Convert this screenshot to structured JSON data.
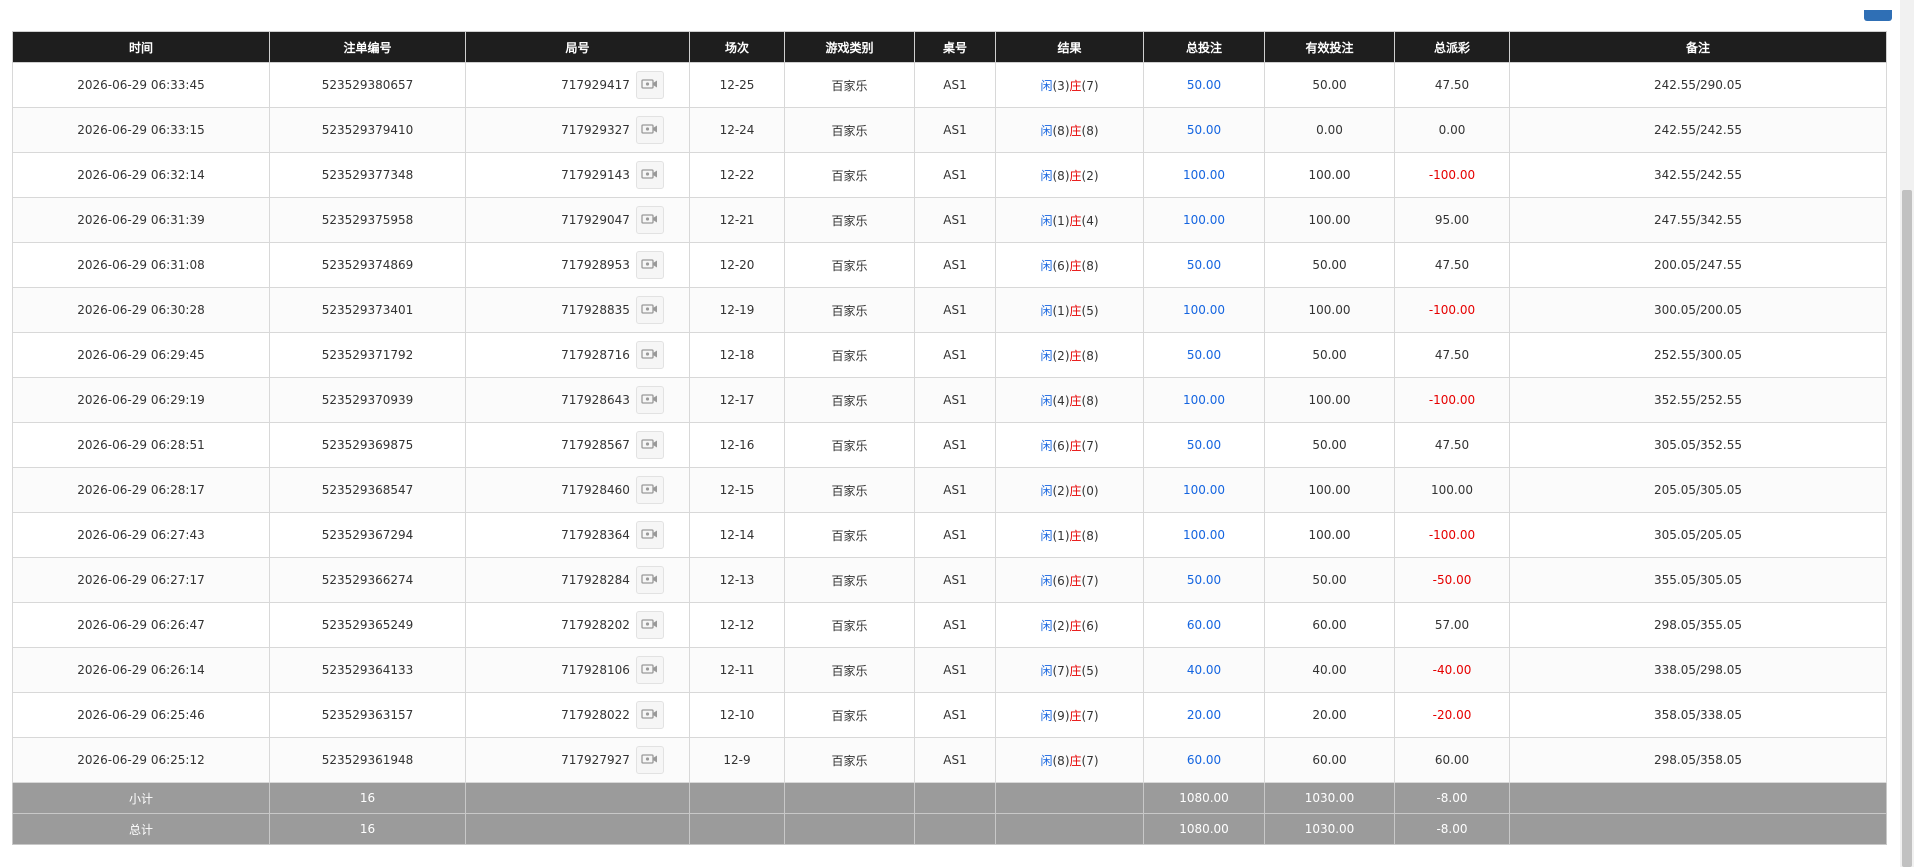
{
  "table": {
    "headers": [
      "时间",
      "注单编号",
      "局号",
      "场次",
      "游戏类别",
      "桌号",
      "结果",
      "总投注",
      "有效投注",
      "总派彩",
      "备注"
    ],
    "rows": [
      {
        "time": "2026-06-29 06:33:45",
        "bet_id": "523529380657",
        "round": "717929417",
        "session": "12-25",
        "game": "百家乐",
        "table": "AS1",
        "res_p_label": "闲",
        "res_p": "(3)",
        "res_b_label": "庄",
        "res_b": "(7)",
        "total_bet": "50.00",
        "valid_bet": "50.00",
        "payout": "47.50",
        "payout_negative": false,
        "note": "242.55/290.05"
      },
      {
        "time": "2026-06-29 06:33:15",
        "bet_id": "523529379410",
        "round": "717929327",
        "session": "12-24",
        "game": "百家乐",
        "table": "AS1",
        "res_p_label": "闲",
        "res_p": "(8)",
        "res_b_label": "庄",
        "res_b": "(8)",
        "total_bet": "50.00",
        "valid_bet": "0.00",
        "payout": "0.00",
        "payout_negative": false,
        "note": "242.55/242.55"
      },
      {
        "time": "2026-06-29 06:32:14",
        "bet_id": "523529377348",
        "round": "717929143",
        "session": "12-22",
        "game": "百家乐",
        "table": "AS1",
        "res_p_label": "闲",
        "res_p": "(8)",
        "res_b_label": "庄",
        "res_b": "(2)",
        "total_bet": "100.00",
        "valid_bet": "100.00",
        "payout": "-100.00",
        "payout_negative": true,
        "note": "342.55/242.55"
      },
      {
        "time": "2026-06-29 06:31:39",
        "bet_id": "523529375958",
        "round": "717929047",
        "session": "12-21",
        "game": "百家乐",
        "table": "AS1",
        "res_p_label": "闲",
        "res_p": "(1)",
        "res_b_label": "庄",
        "res_b": "(4)",
        "total_bet": "100.00",
        "valid_bet": "100.00",
        "payout": "95.00",
        "payout_negative": false,
        "note": "247.55/342.55"
      },
      {
        "time": "2026-06-29 06:31:08",
        "bet_id": "523529374869",
        "round": "717928953",
        "session": "12-20",
        "game": "百家乐",
        "table": "AS1",
        "res_p_label": "闲",
        "res_p": "(6)",
        "res_b_label": "庄",
        "res_b": "(8)",
        "total_bet": "50.00",
        "valid_bet": "50.00",
        "payout": "47.50",
        "payout_negative": false,
        "note": "200.05/247.55"
      },
      {
        "time": "2026-06-29 06:30:28",
        "bet_id": "523529373401",
        "round": "717928835",
        "session": "12-19",
        "game": "百家乐",
        "table": "AS1",
        "res_p_label": "闲",
        "res_p": "(1)",
        "res_b_label": "庄",
        "res_b": "(5)",
        "total_bet": "100.00",
        "valid_bet": "100.00",
        "payout": "-100.00",
        "payout_negative": true,
        "note": "300.05/200.05"
      },
      {
        "time": "2026-06-29 06:29:45",
        "bet_id": "523529371792",
        "round": "717928716",
        "session": "12-18",
        "game": "百家乐",
        "table": "AS1",
        "res_p_label": "闲",
        "res_p": "(2)",
        "res_b_label": "庄",
        "res_b": "(8)",
        "total_bet": "50.00",
        "valid_bet": "50.00",
        "payout": "47.50",
        "payout_negative": false,
        "note": "252.55/300.05"
      },
      {
        "time": "2026-06-29 06:29:19",
        "bet_id": "523529370939",
        "round": "717928643",
        "session": "12-17",
        "game": "百家乐",
        "table": "AS1",
        "res_p_label": "闲",
        "res_p": "(4)",
        "res_b_label": "庄",
        "res_b": "(8)",
        "total_bet": "100.00",
        "valid_bet": "100.00",
        "payout": "-100.00",
        "payout_negative": true,
        "note": "352.55/252.55"
      },
      {
        "time": "2026-06-29 06:28:51",
        "bet_id": "523529369875",
        "round": "717928567",
        "session": "12-16",
        "game": "百家乐",
        "table": "AS1",
        "res_p_label": "闲",
        "res_p": "(6)",
        "res_b_label": "庄",
        "res_b": "(7)",
        "total_bet": "50.00",
        "valid_bet": "50.00",
        "payout": "47.50",
        "payout_negative": false,
        "note": "305.05/352.55"
      },
      {
        "time": "2026-06-29 06:28:17",
        "bet_id": "523529368547",
        "round": "717928460",
        "session": "12-15",
        "game": "百家乐",
        "table": "AS1",
        "res_p_label": "闲",
        "res_p": "(2)",
        "res_b_label": "庄",
        "res_b": "(0)",
        "total_bet": "100.00",
        "valid_bet": "100.00",
        "payout": "100.00",
        "payout_negative": false,
        "note": "205.05/305.05"
      },
      {
        "time": "2026-06-29 06:27:43",
        "bet_id": "523529367294",
        "round": "717928364",
        "session": "12-14",
        "game": "百家乐",
        "table": "AS1",
        "res_p_label": "闲",
        "res_p": "(1)",
        "res_b_label": "庄",
        "res_b": "(8)",
        "total_bet": "100.00",
        "valid_bet": "100.00",
        "payout": "-100.00",
        "payout_negative": true,
        "note": "305.05/205.05"
      },
      {
        "time": "2026-06-29 06:27:17",
        "bet_id": "523529366274",
        "round": "717928284",
        "session": "12-13",
        "game": "百家乐",
        "table": "AS1",
        "res_p_label": "闲",
        "res_p": "(6)",
        "res_b_label": "庄",
        "res_b": "(7)",
        "total_bet": "50.00",
        "valid_bet": "50.00",
        "payout": "-50.00",
        "payout_negative": true,
        "note": "355.05/305.05"
      },
      {
        "time": "2026-06-29 06:26:47",
        "bet_id": "523529365249",
        "round": "717928202",
        "session": "12-12",
        "game": "百家乐",
        "table": "AS1",
        "res_p_label": "闲",
        "res_p": "(2)",
        "res_b_label": "庄",
        "res_b": "(6)",
        "total_bet": "60.00",
        "valid_bet": "60.00",
        "payout": "57.00",
        "payout_negative": false,
        "note": "298.05/355.05"
      },
      {
        "time": "2026-06-29 06:26:14",
        "bet_id": "523529364133",
        "round": "717928106",
        "session": "12-11",
        "game": "百家乐",
        "table": "AS1",
        "res_p_label": "闲",
        "res_p": "(7)",
        "res_b_label": "庄",
        "res_b": "(5)",
        "total_bet": "40.00",
        "valid_bet": "40.00",
        "payout": "-40.00",
        "payout_negative": true,
        "note": "338.05/298.05"
      },
      {
        "time": "2026-06-29 06:25:46",
        "bet_id": "523529363157",
        "round": "717928022",
        "session": "12-10",
        "game": "百家乐",
        "table": "AS1",
        "res_p_label": "闲",
        "res_p": "(9)",
        "res_b_label": "庄",
        "res_b": "(7)",
        "total_bet": "20.00",
        "valid_bet": "20.00",
        "payout": "-20.00",
        "payout_negative": true,
        "note": "358.05/338.05"
      },
      {
        "time": "2026-06-29 06:25:12",
        "bet_id": "523529361948",
        "round": "717927927",
        "session": "12-9",
        "game": "百家乐",
        "table": "AS1",
        "res_p_label": "闲",
        "res_p": "(8)",
        "res_b_label": "庄",
        "res_b": "(7)",
        "total_bet": "60.00",
        "valid_bet": "60.00",
        "payout": "60.00",
        "payout_negative": false,
        "note": "298.05/358.05"
      }
    ],
    "subtotal": {
      "label": "小计",
      "count": "16",
      "total_bet": "1080.00",
      "valid_bet": "1030.00",
      "payout": "-8.00"
    },
    "grand_total": {
      "label": "总计",
      "count": "16",
      "total_bet": "1080.00",
      "valid_bet": "1030.00",
      "payout": "-8.00"
    }
  },
  "icons": {
    "replay": "video-replay-icon"
  },
  "colors": {
    "header_bg": "#1e1e1e",
    "summary_bg": "#9b9b9b",
    "link_blue": "#1565e0",
    "negative_red": "#e60000"
  }
}
